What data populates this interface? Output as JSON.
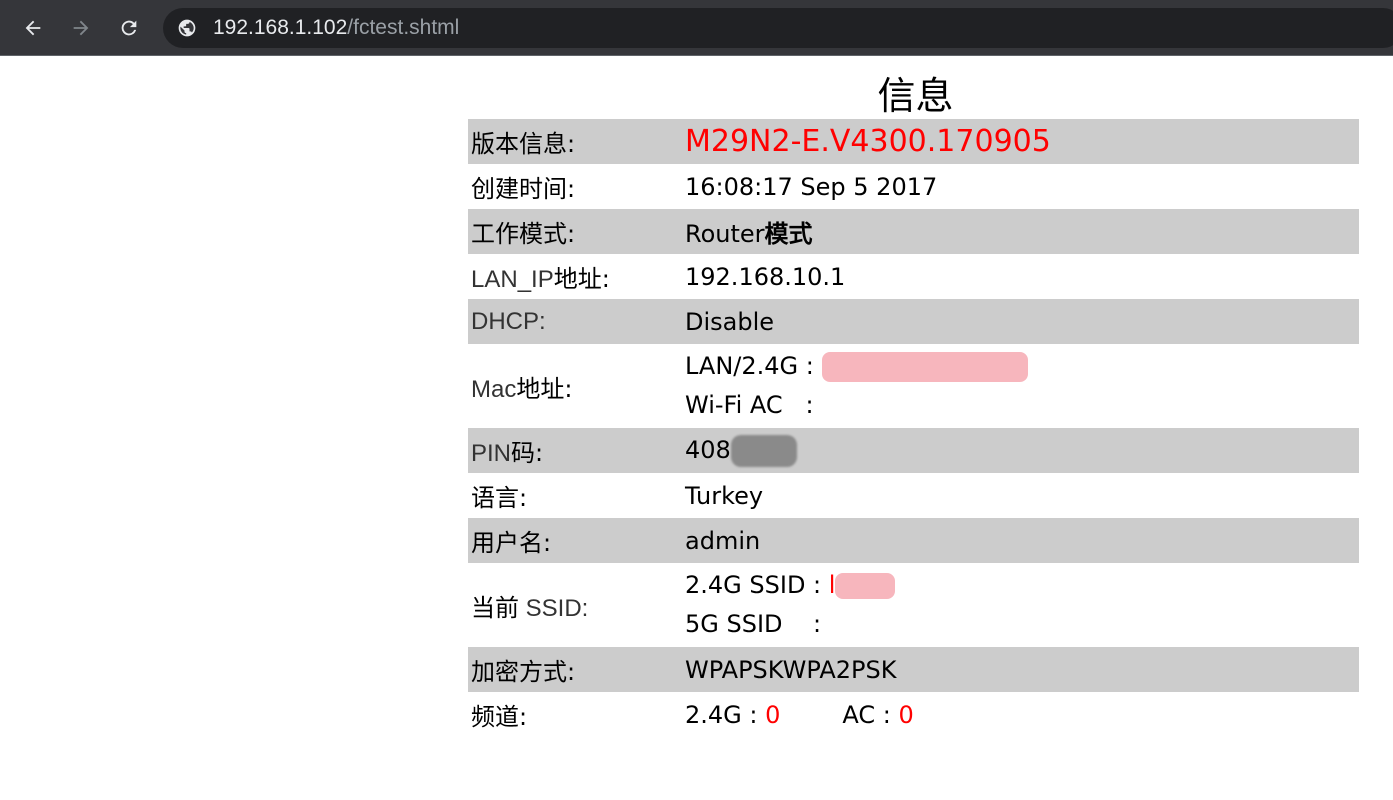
{
  "browser": {
    "url_host": "192.168.1.102",
    "url_path": "/fctest.shtml"
  },
  "page": {
    "title": "信息",
    "rows": {
      "version": {
        "label": "版本信息:",
        "value": "M29N2-E.V4300.170905"
      },
      "build_time": {
        "label": "创建时间:",
        "value": "16:08:17 Sep 5 2017"
      },
      "work_mode": {
        "label": "工作模式:",
        "value_prefix": "Router",
        "value_bold": "模式"
      },
      "lan_ip": {
        "label_latin": "LAN_IP",
        "label_cjk": "地址:",
        "value": "192.168.10.1"
      },
      "dhcp": {
        "label": "DHCP:",
        "value": "Disable"
      },
      "mac": {
        "label_latin": "Mac",
        "label_cjk": "地址:",
        "line1_prefix": "LAN/2.4G :",
        "line2_prefix": "Wi-Fi AC   :"
      },
      "pin": {
        "label_latin": "PIN",
        "label_cjk": "码:",
        "value_visible": "408"
      },
      "language": {
        "label": "语言:",
        "value": "Turkey"
      },
      "username": {
        "label": "用户名:",
        "value": "admin"
      },
      "ssid": {
        "label_cjk": "当前",
        "label_latin": " SSID:",
        "line1_prefix": "2.4G SSID :",
        "line1_visible": "l",
        "line2_prefix": "5G SSID    :"
      },
      "encryption": {
        "label": "加密方式:",
        "value": "WPAPSKWPA2PSK"
      },
      "channel": {
        "label": "频道:",
        "g24_prefix": "2.4G :",
        "g24_value": "0",
        "ac_prefix": "AC :",
        "ac_value": "0"
      }
    }
  },
  "colors": {
    "toolbar_bg": "#35363a",
    "omnibox_bg": "#202124",
    "row_shade": "#cccccc",
    "highlight_red": "#ff0000",
    "redaction_pink": "#f6a9b1",
    "redaction_grey": "#8a8a8a"
  },
  "icons": {
    "back": "arrow-left-icon",
    "forward": "arrow-right-icon",
    "reload": "reload-icon",
    "site": "globe-icon"
  }
}
